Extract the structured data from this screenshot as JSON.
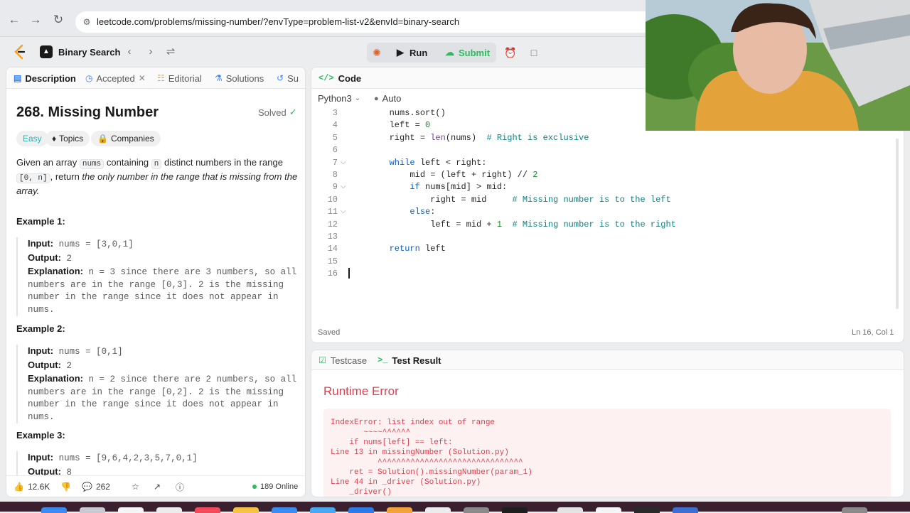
{
  "browser": {
    "url": "leetcode.com/problems/missing-number/?envType=problem-list-v2&envId=binary-search"
  },
  "header": {
    "problem_list_label": "Binary Search",
    "run_label": "Run",
    "submit_label": "Submit"
  },
  "left_panel": {
    "tabs": [
      {
        "label": "Description",
        "icon": "description-icon"
      },
      {
        "label": "Accepted",
        "icon": "clock-icon"
      },
      {
        "label": "Editorial",
        "icon": "book-icon"
      },
      {
        "label": "Solutions",
        "icon": "flask-icon"
      },
      {
        "label": "Su",
        "icon": "submissions-icon"
      }
    ],
    "title": "268. Missing Number",
    "solved_label": "Solved",
    "tags": {
      "difficulty": "Easy",
      "topics": "Topics",
      "companies": "Companies"
    },
    "description": {
      "p1": "Given an array ",
      "code1": "nums",
      "p2": " containing ",
      "code2": "n",
      "p3": " distinct numbers in the range ",
      "code3": "[0, n]",
      "p4": ", return ",
      "p5": "the only number in the range that is missing from the array."
    },
    "examples": [
      {
        "title": "Example 1:",
        "input_label": "Input:",
        "input": "nums = [3,0,1]",
        "output_label": "Output:",
        "output": "2",
        "explanation_label": "Explanation:",
        "explanation": "n = 3 since there are 3 numbers, so all numbers are in the range [0,3]. 2 is the missing number in the range since it does not appear in nums."
      },
      {
        "title": "Example 2:",
        "input_label": "Input:",
        "input": "nums = [0,1]",
        "output_label": "Output:",
        "output": "2",
        "explanation_label": "Explanation:",
        "explanation": "n = 2 since there are 2 numbers, so all numbers are in the range [0,2]. 2 is the missing number in the range since it does not appear in nums."
      },
      {
        "title": "Example 3:",
        "input_label": "Input:",
        "input": "nums = [9,6,4,2,3,5,7,0,1]",
        "output_label": "Output:",
        "output": "8"
      }
    ],
    "footer": {
      "likes": "12.6K",
      "comments": "262",
      "online": "189 Online"
    }
  },
  "code_panel": {
    "tab_label": "Code",
    "language": "Python3",
    "auto_label": "Auto",
    "lines": [
      {
        "n": "3",
        "text": "        nums.sort()"
      },
      {
        "n": "4",
        "text": "        left = 0"
      },
      {
        "n": "5",
        "text": "        right = len(nums)  # Right is exclusive"
      },
      {
        "n": "6",
        "text": ""
      },
      {
        "n": "7",
        "text": "        while left < right:",
        "fold": true
      },
      {
        "n": "8",
        "text": "            mid = (left + right) // 2"
      },
      {
        "n": "9",
        "text": "            if nums[mid] > mid:",
        "fold": true
      },
      {
        "n": "10",
        "text": "                right = mid     # Missing number is to the left"
      },
      {
        "n": "11",
        "text": "            else:",
        "fold": true
      },
      {
        "n": "12",
        "text": "                left = mid + 1  # Missing number is to the right"
      },
      {
        "n": "13",
        "text": ""
      },
      {
        "n": "14",
        "text": "        return left"
      },
      {
        "n": "15",
        "text": ""
      },
      {
        "n": "16",
        "text": ""
      }
    ],
    "status": "Saved",
    "cursor_position": "Ln 16, Col 1"
  },
  "test_panel": {
    "testcase_label": "Testcase",
    "result_label": "Test Result",
    "error_title": "Runtime Error",
    "error_lines": [
      "IndexError: list index out of range",
      "       ~~~~^^^^^^",
      "    if nums[left] == left:",
      "Line 13 in missingNumber (Solution.py)",
      "          ^^^^^^^^^^^^^^^^^^^^^^^^^^^^^^^",
      "    ret = Solution().missingNumber(param_1)",
      "Line 44 in _driver (Solution.py)",
      "    _driver()"
    ]
  },
  "colors": {
    "accent_green": "#2cbb5d",
    "error_red": "#e0404f",
    "easy_teal": "#1cb8b8"
  }
}
